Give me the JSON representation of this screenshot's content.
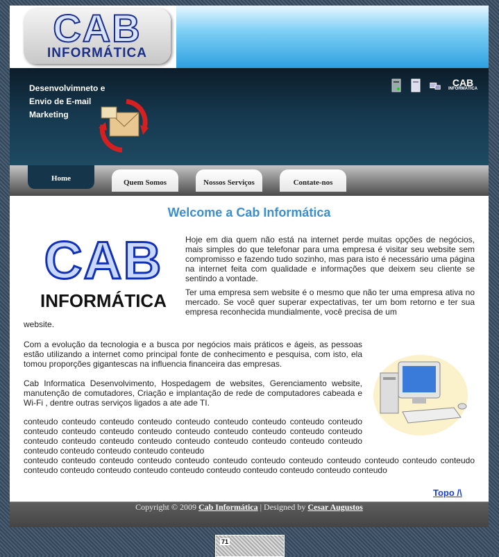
{
  "header": {
    "logo_main": "CAB",
    "logo_sub": "INFORMÁTICA",
    "mini_logo_main": "CAB",
    "mini_logo_sub": "INFORMÁTICA"
  },
  "banner": {
    "text": "Desenvolvimneto e Envio de E-mail Marketing"
  },
  "nav": {
    "tabs": [
      {
        "label": "Home"
      },
      {
        "label": "Quem Somos"
      },
      {
        "label": "Nossos Serviços"
      },
      {
        "label": "Contate-nos"
      }
    ]
  },
  "main": {
    "title": "Welcome a Cab Informática",
    "big_logo_main": "CAB",
    "big_logo_sub": "INFORMÁTICA",
    "p1": "Hoje em dia quem não está na internet perde muitas opções de negócios, mais simples do que telefonar para uma empresa é visitar seu website sem compromisso e fazendo tudo sozinho, mas para isto é necessário uma página na internet feita com qualidade e informações que deixem seu cliente se sentindo a vontade.",
    "p2": "Ter uma empresa sem website é o mesmo que não ter uma empresa ativa no mercado. Se você quer superar expectativas, ter um bom retorno e ter sua empresa reconhecida mundialmente, você precisa de um",
    "p2_end": "website.",
    "p3": "Com a evolução da tecnologia e a busca por negócios mais práticos e ágeis, as pessoas estão utilizando a internet como principal fonte de conhecimento e pesquisa, com isto, ela tomou proporções gigantescas na influencia financeira das empresas.",
    "p4": "Cab Informatica Desenvolvimento, Hospedagem de websites, Gerenciamento website, manutenção de comutadores, Criação e implantação de rede de computadores cabeada e Wi-Fi , dentre outras serviços ligados a ate ade TI.",
    "p5": "conteudo conteudo conteudo conteudo conteudo conteudo conteudo conteudo conteudo conteudo conteudo conteudo conteudo conteudo conteudo conteudo conteudo conteudo conteudo conteudo conteudo conteudo conteudo conteudo conteudo conteudo conteudo conteudo conteudo conteudo conteudo conteudo",
    "p6": "conteudo conteudo conteudo conteudo conteudo conteudo conteudo conteudo conteudo conteudo conteudo conteudo conteudo conteudo conteudo conteudo conteudo conteudo conteudo conteudo conteudo conteudo",
    "topo": "Topo /\\"
  },
  "footer": {
    "copyright": "Copyright © 2009",
    "company_link": "Cab Informática",
    "separator": "| Designed by",
    "designer_link": "Cesar Augustos"
  },
  "counter": {
    "value": "71"
  }
}
